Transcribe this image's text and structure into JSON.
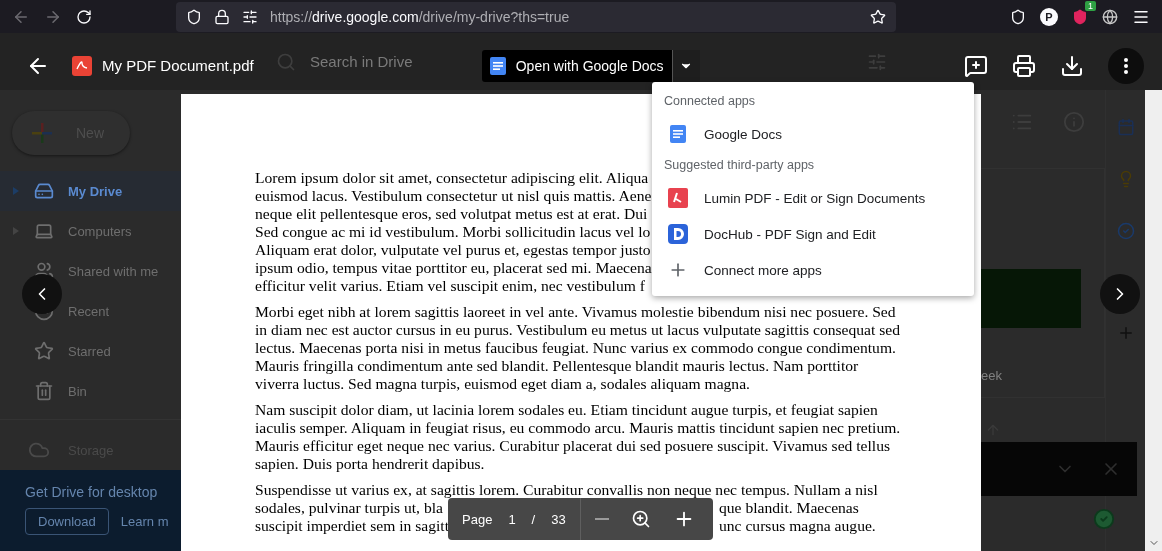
{
  "browser": {
    "url_prefix": "https://",
    "url_domain": "drive.google.com",
    "url_path": "/drive/my-drive?ths=true",
    "back_disabled": true,
    "forward_disabled": true,
    "profile_initial": "P",
    "extension_badge": "1"
  },
  "drive": {
    "search": {
      "placeholder": "Search in Drive"
    },
    "new_button": "New",
    "sidebar": [
      {
        "label": "My Drive",
        "kind": "drive",
        "selected": true,
        "expandable": true
      },
      {
        "label": "Computers",
        "kind": "computers",
        "selected": false,
        "expandable": true
      },
      {
        "label": "Shared with me",
        "kind": "shared",
        "selected": false,
        "expandable": false
      },
      {
        "label": "Recent",
        "kind": "recent",
        "selected": false,
        "expandable": false
      },
      {
        "label": "Starred",
        "kind": "starred",
        "selected": false,
        "expandable": false
      },
      {
        "label": "Bin",
        "kind": "bin",
        "selected": false,
        "expandable": false
      }
    ],
    "storage": "Storage",
    "promo": {
      "title": "Get Drive for desktop",
      "button": "Download",
      "link": "Learn m"
    },
    "content_fragment": "eek"
  },
  "viewer": {
    "file_name": "My PDF Document.pdf",
    "open_button": "Open with Google Docs",
    "menu_expanded": true,
    "menu": {
      "sections": [
        {
          "title": "Connected apps",
          "items": [
            {
              "label": "Google Docs",
              "kind": "docs"
            }
          ]
        },
        {
          "title": "Suggested third-party apps",
          "items": [
            {
              "label": "Lumin PDF - Edit or Sign Documents",
              "kind": "lumin"
            },
            {
              "label": "DocHub - PDF Sign and Edit",
              "kind": "dochub"
            }
          ]
        }
      ],
      "footer": "Connect more apps"
    },
    "page": {
      "paragraphs": [
        {
          "lines": [
            [
              "Lorem ipsum dolor sit amet, consectetur adipiscing elit. Aliqua"
            ],
            [
              "euismod lacus. Vestibulum consectetur ut nisl quis mattis. Aene"
            ],
            [
              "neque elit pellentesque eros, sed volutpat metus est at erat. Dui"
            ],
            [
              "Sed congue ac mi id vestibulum. Morbi sollicitudin lacus vel lo"
            ],
            [
              "Aliquam erat dolor, vulputate vel purus et, egestas tempor justo"
            ],
            [
              "ipsum odio, tempus vitae porttitor eu, placerat sed mi. Maecena"
            ],
            [
              "efficitur velit varius. Etiam vel suscipit enim, nec vestibulum f"
            ]
          ]
        },
        {
          "lines": [
            [
              "Morbi eget nibh at lorem sagittis laoreet in vel ante. Vivamus molestie bibendum nisi nec posuere. Sed"
            ],
            [
              "in diam nec est auctor cursus in eu purus. Vestibulum eu metus ut lacus vulputate sagittis consequat sed"
            ],
            [
              "lectus. Maecenas porta nisi in metus faucibus feugiat. Nunc varius ex commodo congue condimentum."
            ],
            [
              "Mauris fringilla condimentum ante sed blandit. Pellentesque blandit mauris lectus. Nam porttitor"
            ],
            [
              "viverra luctus. Sed magna turpis, euismod eget diam a, sodales aliquam magna."
            ]
          ]
        },
        {
          "lines": [
            [
              "Nam suscipit dolor diam, ut lacinia lorem sodales eu. Etiam tincidunt augue turpis, et feugiat sapien"
            ],
            [
              "iaculis semper. Aliquam in feugiat risus, eu commodo arcu. Mauris mattis tincidunt sapien nec pretium."
            ],
            [
              "Mauris efficitur eget neque nec varius. Curabitur placerat dui sed posuere suscipit. Vivamus sed tellus"
            ],
            [
              "sapien. Duis porta hendrerit dapibus."
            ]
          ]
        },
        {
          "lines": [
            [
              "Suspendisse ut varius ex, at sagittis lorem. Curabitur convallis non neque nec tempus. Nullam a nisl"
            ],
            [
              "sodales, pulvinar turpis ut, bla",
              "que blandit. Maecenas"
            ],
            [
              "suscipit imperdiet sem in sagitt",
              "unc cursus magna augue."
            ]
          ]
        }
      ]
    },
    "toolbar": {
      "label": "Page",
      "current": "1",
      "separator": "/",
      "total": "33"
    }
  }
}
